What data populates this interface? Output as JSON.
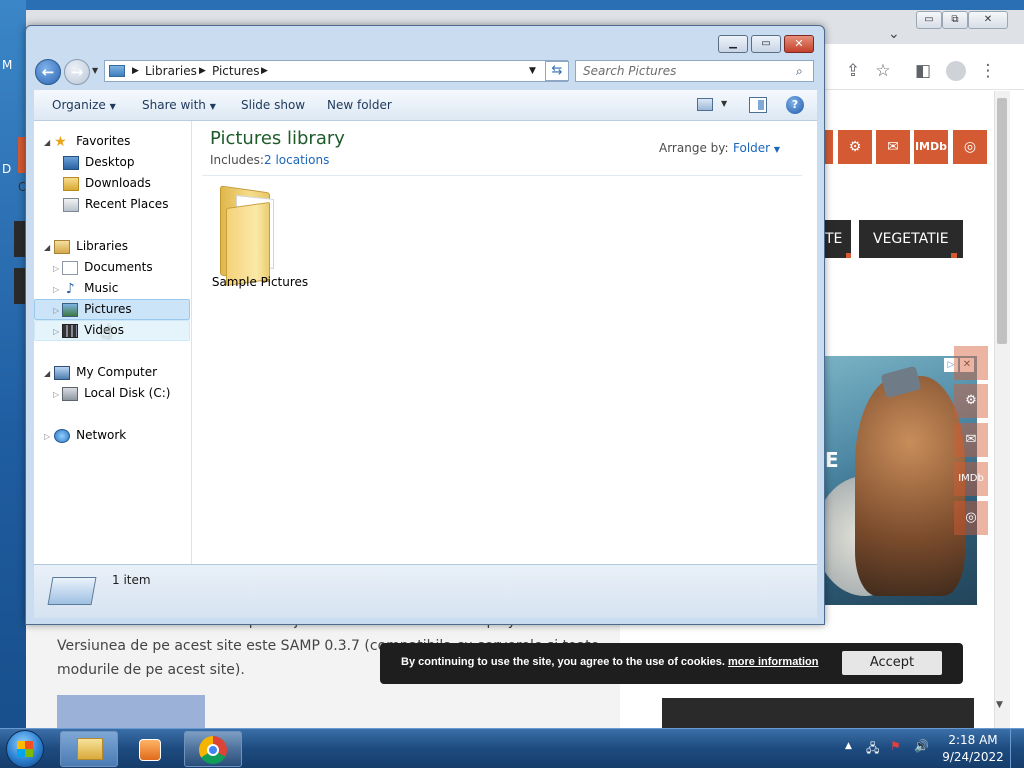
{
  "desktop": {
    "letters": [
      "M",
      "D",
      "C"
    ]
  },
  "browser": {
    "window_controls": {
      "minimize": "▭",
      "restore": "⧉",
      "close": "✕"
    },
    "toolbar_icons": [
      "share-icon",
      "star-icon",
      "sidebar-icon",
      "profile-icon",
      "menu-icon"
    ],
    "chevron": "⌄",
    "social_icons": [
      "steam-icon",
      "mail-icon",
      "imdb-icon",
      "instagram-icon"
    ],
    "social_labels": {
      "imdb": "IMDb"
    },
    "categories": [
      "TE",
      "VEGETATIE"
    ],
    "ad_heading": "E",
    "text_lines": [
      "SAMP este un mod cu care puteti juca GTA San Andreas Multiplayer.",
      "Versiunea de pe acest site este SAMP 0.3.7 (compatibila cu serverele si toate",
      "modurile de pe acest site)."
    ],
    "cookie": {
      "text": "By continuing to use the site, you agree to the use of cookies.",
      "link": "more information",
      "accept": "Accept"
    }
  },
  "explorer": {
    "address": {
      "segments": [
        "Libraries",
        "Pictures"
      ]
    },
    "search_placeholder": "Search Pictures",
    "commands": [
      "Organize",
      "Share with",
      "Slide show",
      "New folder"
    ],
    "help": "?",
    "nav": {
      "favorites": {
        "label": "Favorites",
        "items": [
          "Desktop",
          "Downloads",
          "Recent Places"
        ]
      },
      "libraries": {
        "label": "Libraries",
        "items": [
          "Documents",
          "Music",
          "Pictures",
          "Videos"
        ]
      },
      "computer": {
        "label": "My Computer",
        "items": [
          "Local Disk (C:)"
        ]
      },
      "network": {
        "label": "Network"
      }
    },
    "library": {
      "title": "Pictures library",
      "includes_label": "Includes:",
      "includes_link": "2 locations",
      "arrange_label": "Arrange by:",
      "arrange_value": "Folder"
    },
    "items": [
      {
        "name": "Sample Pictures"
      }
    ],
    "status": "1 item"
  },
  "taskbar": {
    "time": "2:18 AM",
    "date": "9/24/2022",
    "apps": [
      "explorer-icon",
      "media-player-icon",
      "chrome-icon"
    ]
  },
  "colors": {
    "accent": "#d45a34",
    "library_title": "#1e5b2a",
    "link": "#1a66b8"
  }
}
